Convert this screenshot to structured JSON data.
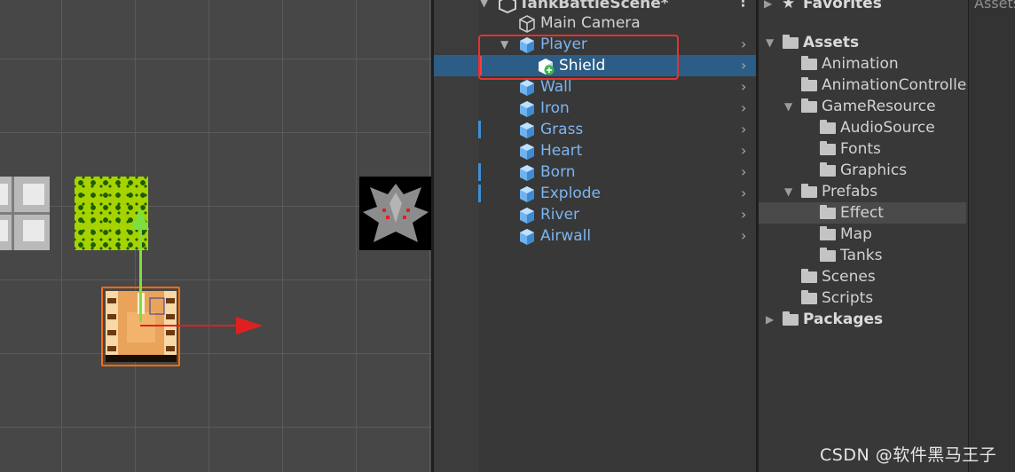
{
  "hierarchy": {
    "scene_title": "TankBattleScene*",
    "items": [
      {
        "label": "Main Camera"
      },
      {
        "label": "Player"
      },
      {
        "label": "Shield"
      },
      {
        "label": "Wall"
      },
      {
        "label": "Iron"
      },
      {
        "label": "Grass"
      },
      {
        "label": "Heart"
      },
      {
        "label": "Born"
      },
      {
        "label": "Explode"
      },
      {
        "label": "River"
      },
      {
        "label": "Airwall"
      }
    ]
  },
  "project": {
    "favorites_label": "Favorites",
    "tab_label": "Assets",
    "items": [
      {
        "label": "Assets"
      },
      {
        "label": "Animation"
      },
      {
        "label": "AnimationControlle"
      },
      {
        "label": "GameResource"
      },
      {
        "label": "AudioSource"
      },
      {
        "label": "Fonts"
      },
      {
        "label": "Graphics"
      },
      {
        "label": "Prefabs"
      },
      {
        "label": "Effect"
      },
      {
        "label": "Map"
      },
      {
        "label": "Tanks"
      },
      {
        "label": "Scenes"
      },
      {
        "label": "Scripts"
      },
      {
        "label": "Packages"
      }
    ]
  },
  "watermark": "CSDN @软件黑马王子",
  "colors": {
    "prefab_text": "#7cb5f0",
    "selection": "#2c5d87",
    "highlight_box": "#e33333",
    "gizmo_x": "#e02020",
    "gizmo_y": "#7ede40",
    "selection_outline": "#ff6c0a"
  }
}
